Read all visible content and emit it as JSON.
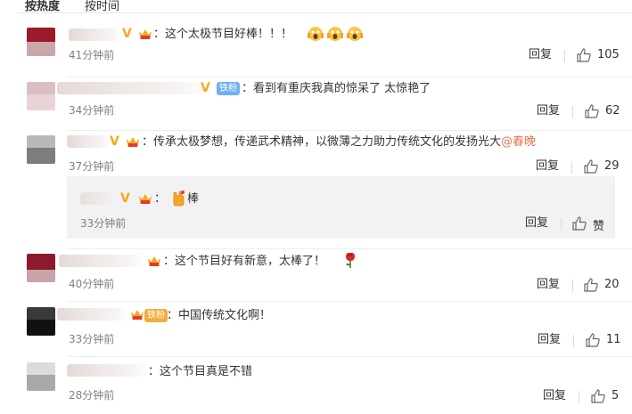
{
  "tabs": {
    "hot": "按热度",
    "time": "按时间"
  },
  "comments": [
    {
      "text": "：这个太极节目好棒！！！",
      "time": "41分钟前",
      "reply": "回复",
      "likes": "105"
    },
    {
      "badge": "铁粉",
      "text": "：看到有重庆我真的惊呆了 太惊艳了",
      "time": "34分钟前",
      "reply": "回复",
      "likes": "62"
    },
    {
      "text": "：传承太极梦想，传递武术精神，以微薄之力助力传统文化的发扬光大",
      "mention": "@春晚",
      "time": "37分钟前",
      "reply": "回复",
      "likes": "29"
    },
    {
      "text": "棒",
      "time": "33分钟前",
      "reply": "回复",
      "like_label": "赞"
    },
    {
      "text": "：这个节目好有新意，太棒了！",
      "time": "40分钟前",
      "reply": "回复",
      "likes": "20"
    },
    {
      "badge": "铁粉",
      "text": "：中国传统文化啊！",
      "time": "33分钟前",
      "reply": "回复",
      "likes": "11"
    },
    {
      "text": "：这个节目真是不错",
      "time": "28分钟前",
      "reply": "回复",
      "likes": "5"
    }
  ],
  "colors": {
    "mention": "#eb7350",
    "verified": "#f6a91a",
    "fan_badge": "#6fb0f2",
    "fan_badge_gold": "#f0ad3a",
    "sub_bg": "#f2f2f5"
  },
  "icons": [
    "thumbs-up-icon",
    "verified-v-icon",
    "crown-icon",
    "emoji-scream-icon",
    "hand-emoji-icon",
    "rose-icon"
  ]
}
